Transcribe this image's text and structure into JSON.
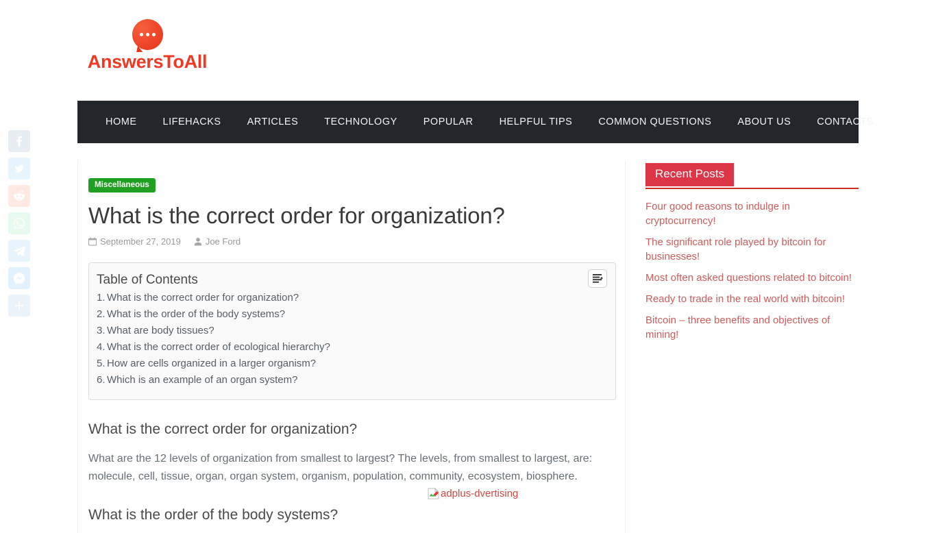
{
  "site": {
    "logo_text": "AnswersToAll",
    "logo_icon": "speech-bubble-icon",
    "brand_color": "#ee3a24"
  },
  "nav": {
    "items": [
      {
        "label": "HOME"
      },
      {
        "label": "LIFEHACKS"
      },
      {
        "label": "ARTICLES"
      },
      {
        "label": "TECHNOLOGY"
      },
      {
        "label": "POPULAR"
      },
      {
        "label": "HELPFUL TIPS"
      },
      {
        "label": "COMMON QUESTIONS"
      },
      {
        "label": "ABOUT US"
      },
      {
        "label": "CONTACTS"
      }
    ],
    "background_color": "#23272b"
  },
  "social_share": {
    "items": [
      {
        "name": "facebook",
        "color": "#3b5998"
      },
      {
        "name": "twitter",
        "color": "#1da1f2"
      },
      {
        "name": "reddit",
        "color": "#ff4500"
      },
      {
        "name": "whatsapp",
        "color": "#25d366"
      },
      {
        "name": "telegram",
        "color": "#2ca5e0"
      },
      {
        "name": "messenger",
        "color": "#0084ff"
      },
      {
        "name": "share-more",
        "color": "#4a90d9"
      }
    ]
  },
  "article": {
    "category": "Miscellaneous",
    "category_color": "#20a020",
    "title": "What is the correct order for organization?",
    "date": "September 27, 2019",
    "author": "Joe Ford",
    "toc": {
      "title": "Table of Contents",
      "items": [
        {
          "num": "1.",
          "label": "What is the correct order for organization?"
        },
        {
          "num": "2.",
          "label": "What is the order of the body systems?"
        },
        {
          "num": "3.",
          "label": "What are body tissues?"
        },
        {
          "num": "4.",
          "label": "What is the correct order of ecological hierarchy?"
        },
        {
          "num": "5.",
          "label": "How are cells organized in a larger organism?"
        },
        {
          "num": "6.",
          "label": "Which is an example of an organ system?"
        }
      ]
    },
    "sections": [
      {
        "heading": "What is the correct order for organization?",
        "paragraph": "What are the 12 levels of organization from smallest to largest? The levels, from smallest to largest, are: molecule, cell, tissue, organ, organ system, organism, population, community, ecosystem, biosphere."
      },
      {
        "heading": "What is the order of the body systems?"
      }
    ],
    "ad_placeholder_alt": "adplus-dvertising"
  },
  "sidebar": {
    "title": "Recent Posts",
    "title_color": "#dc3545",
    "posts": [
      {
        "label": "Four good reasons to indulge in cryptocurrency!"
      },
      {
        "label": "The significant role played by bitcoin for businesses!"
      },
      {
        "label": "Most often asked questions related to bitcoin!"
      },
      {
        "label": "Ready to trade in the real world with bitcoin!"
      },
      {
        "label": "Bitcoin – three benefits and objectives of mining!"
      }
    ]
  }
}
